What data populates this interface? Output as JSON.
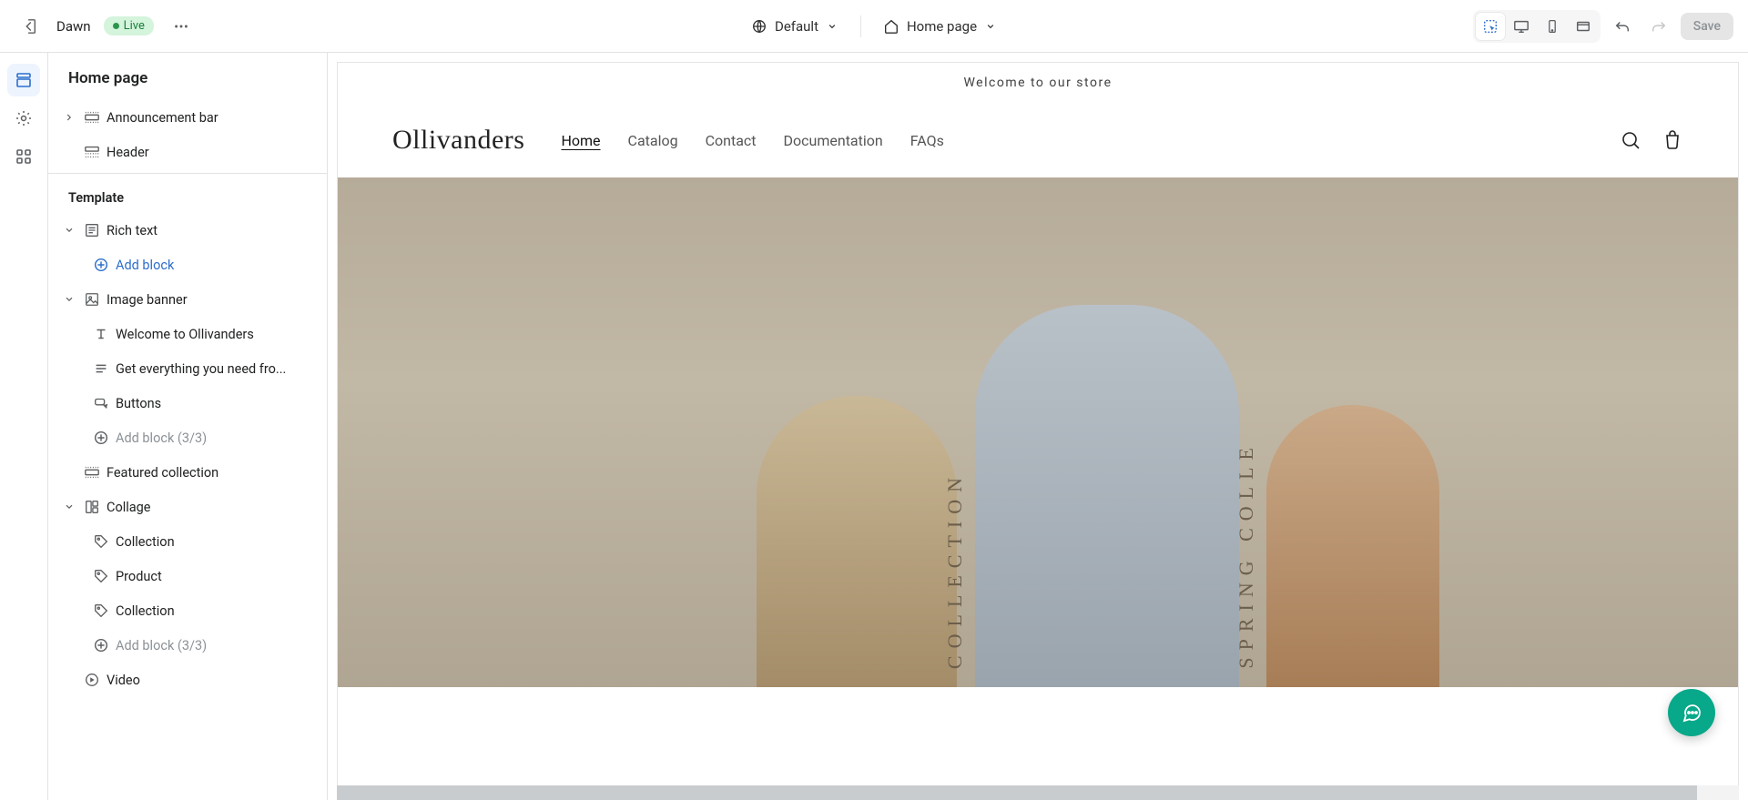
{
  "topbar": {
    "theme_name": "Dawn",
    "live_label": "Live",
    "preset_label": "Default",
    "template_label": "Home page",
    "save_label": "Save"
  },
  "sidebar": {
    "title": "Home page",
    "announcement": "Announcement bar",
    "header": "Header",
    "template_heading": "Template",
    "richtext": "Rich text",
    "add_block": "Add block",
    "image_banner": "Image banner",
    "ib_heading": "Welcome to Ollivanders",
    "ib_text": "Get everything you need fro...",
    "ib_buttons": "Buttons",
    "add_block_3": "Add block (3/3)",
    "featured": "Featured collection",
    "collage": "Collage",
    "collage_collection1": "Collection",
    "collage_product": "Product",
    "collage_collection2": "Collection",
    "video": "Video"
  },
  "preview": {
    "announcement_text": "Welcome to our store",
    "brand": "Ollivanders",
    "nav": {
      "home": "Home",
      "catalog": "Catalog",
      "contact": "Contact",
      "documentation": "Documentation",
      "faqs": "FAQs"
    },
    "vtext1": "COLLECTION",
    "vtext2": "SPRING COLLE"
  }
}
